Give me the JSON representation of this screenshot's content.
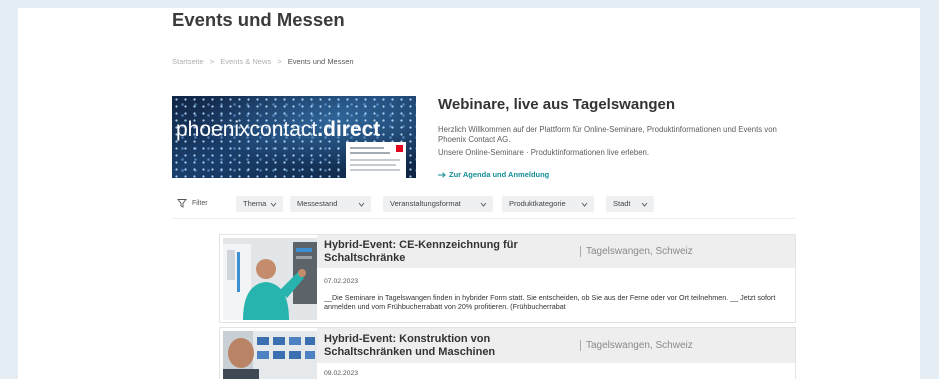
{
  "page": {
    "title": "Events und Messen"
  },
  "breadcrumb": {
    "items": [
      "Startseite",
      "Events & News",
      "Events und Messen"
    ],
    "separator": ">"
  },
  "banner": {
    "brand_main": "phoenixcontact",
    "brand_suffix": ".direct"
  },
  "intro": {
    "heading": "Webinare, live aus Tagelswangen",
    "paragraph_1": "Herzlich Willkommen auf der Plattform für Online-Seminare, Produktinformationen und Events von Phoenix Contact AG.",
    "paragraph_2": "Unsere Online-Seminare · Produktinformationen live erleben.",
    "link": "Zur Agenda und Anmeldung",
    "link_icon": "arrow-right-icon"
  },
  "filters": {
    "label": "Filter",
    "icon": "filter-icon",
    "option_icon": "chevron-down-icon",
    "options": [
      "Thema",
      "Messestand",
      "Veranstaltungsformat",
      "Produktkategorie",
      "Stadt"
    ]
  },
  "events": [
    {
      "title": "Hybrid-Event: CE-Kennzeichnung für Schaltschränke",
      "location": "Tagelswangen, Schweiz",
      "date": "07.02.2023",
      "description": "__Die Seminare in Tagelswangen finden in hybrider Form statt. Sie entscheiden, ob Sie aus der Ferne oder vor Ort teilnehmen. __ Jetzt sofort anmelden und vom Frühbucherrabatt von 20% profitieren. (Frühbucherrabat"
    },
    {
      "title": "Hybrid-Event: Konstruktion von Schaltschränken und Maschinen",
      "location": "Tagelswangen, Schweiz",
      "date": "09.02.2023"
    }
  ],
  "colors": {
    "accent": "#138d95",
    "page_border": "#e4eef4",
    "card_header": "#eeeeee",
    "filter_button": "#eef0f2",
    "brand_red": "#e2001a",
    "banner_navy": "#1a3f6c"
  }
}
